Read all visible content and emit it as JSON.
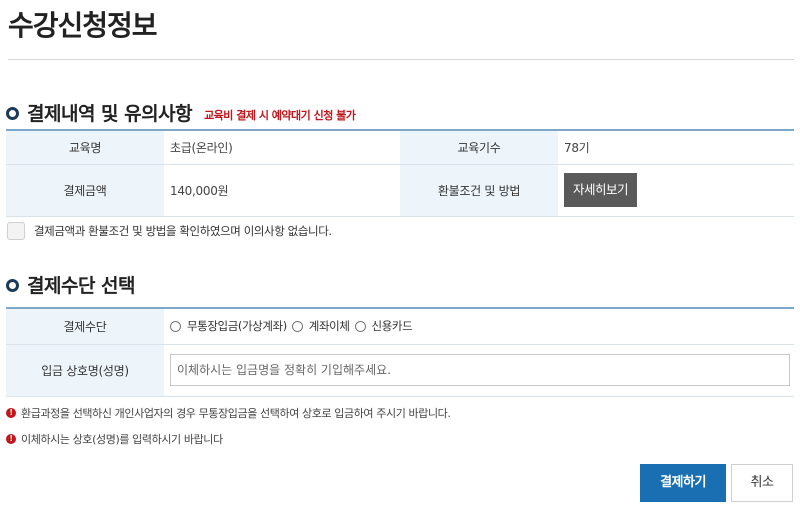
{
  "page": {
    "title": "수강신청정보"
  },
  "payment_info": {
    "title": "결제내역 및 유의사항",
    "warning": "교육비 결제 시 예약대기 신청 불가",
    "rows": [
      {
        "label1": "교육명",
        "value1": "초급(온라인)",
        "label2": "교육기수",
        "value2": "78기"
      },
      {
        "label1": "결제금액",
        "value1": "140,000원",
        "label2": "환불조건 및 방법",
        "button": "자세히보기"
      }
    ],
    "agree_text": "결제금액과 환불조건 및 방법을 확인하였으며 이의사항 없습니다."
  },
  "payment_method": {
    "title": "결제수단 선택",
    "method_label": "결제수단",
    "options": [
      "무통장입금(가상계좌)",
      "계좌이체",
      "신용카드"
    ],
    "depositor_label": "입금 상호명(성명)",
    "depositor_placeholder": "이체하시는 입금명을 정확히 기입해주세요."
  },
  "notices": [
    "환급과정을 선택하신 개인사업자의 경우 무통장입금을 선택하여 상호로 입금하여 주시기 바랍니다.",
    "이체하시는 상호(성명)를 입력하시기 바랍니다"
  ],
  "actions": {
    "pay": "결제하기",
    "cancel": "취소"
  },
  "colors": {
    "accent": "#1a6fb2",
    "warning": "#c0161c",
    "label_bg": "#eef5fa",
    "table_border": "#7ba7c9"
  }
}
